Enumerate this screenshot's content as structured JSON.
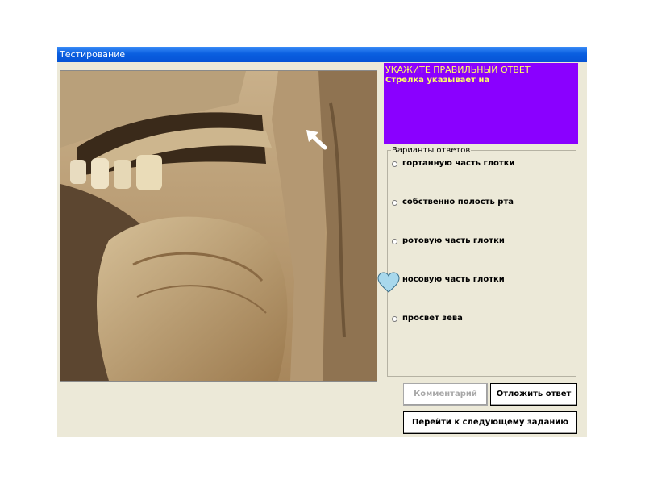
{
  "window": {
    "title": "Тестирование"
  },
  "question": {
    "heading": "УКАЖИТЕ ПРАВИЛЬНЫЙ ОТВЕТ",
    "prompt": "Стрелка указывает на",
    "panel_color": "#8a00ff",
    "text_color": "#ffff66"
  },
  "answers": {
    "legend": "Варианты ответов",
    "options": [
      {
        "label": " гортанную часть глотки",
        "selected": false
      },
      {
        "label": "собственно полость рта",
        "selected": false
      },
      {
        "label": "ротовую часть глотки",
        "selected": false
      },
      {
        "label": "носовую часть глотки",
        "selected": false
      },
      {
        "label": "просвет зева",
        "selected": false
      }
    ]
  },
  "buttons": {
    "comment": {
      "label": "Комментарий",
      "enabled": false
    },
    "postpone": {
      "label": "Отложить ответ",
      "enabled": true
    },
    "next": {
      "label": "Перейти к следующему заданию",
      "enabled": true
    }
  },
  "icons": {
    "cursor": "heart-icon",
    "pointer": "arrow-icon"
  }
}
